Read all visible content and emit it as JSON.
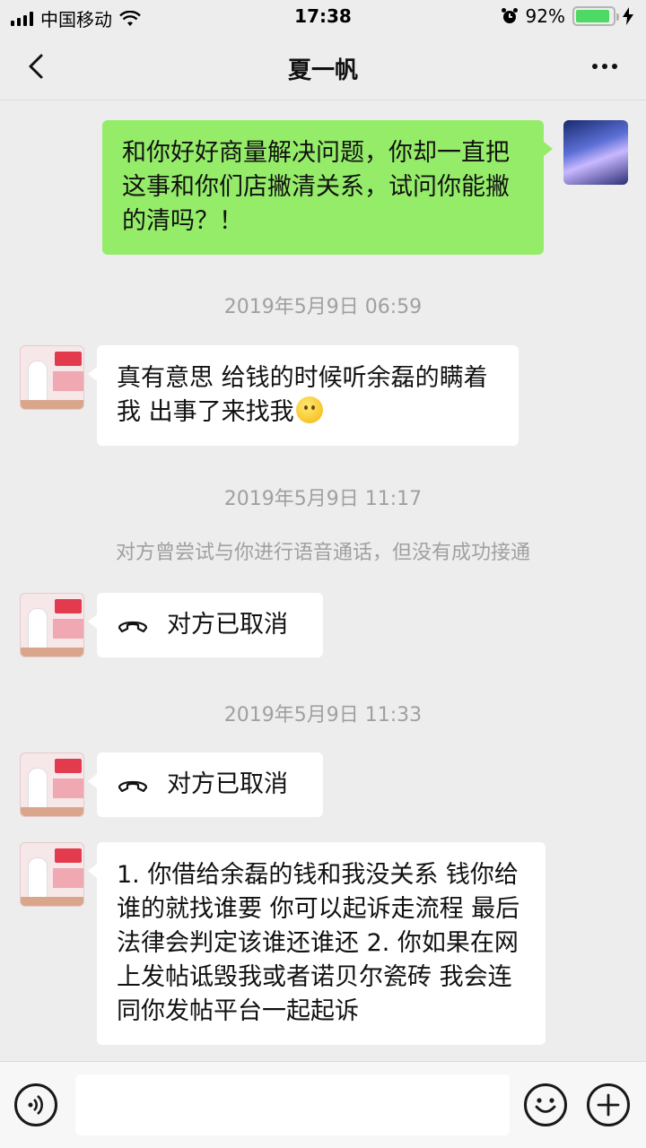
{
  "status_bar": {
    "carrier": "中国移动",
    "time": "17:38",
    "battery_percent": "92%",
    "battery_level": 0.92,
    "icons": [
      "signal-icon",
      "wifi-icon",
      "alarm-icon",
      "battery-icon",
      "charging-icon"
    ]
  },
  "nav": {
    "title": "夏一帆",
    "back_icon": "chevron-left-icon",
    "more_icon": "more-icon"
  },
  "messages": [
    {
      "type": "text",
      "side": "out",
      "text": "和你好好商量解决问题，你却一直把这事和你们店撇清关系，试问你能撇的清吗？！"
    },
    {
      "type": "timestamp",
      "text": "2019年5月9日 06:59"
    },
    {
      "type": "text",
      "side": "in",
      "text": "真有意思 给钱的时候听余磊的瞒着我 出事了来找我",
      "emoji": "smile-emoji"
    },
    {
      "type": "timestamp",
      "text": "2019年5月9日 11:17"
    },
    {
      "type": "system",
      "text": "对方曾尝试与你进行语音通话，但没有成功接通"
    },
    {
      "type": "call",
      "side": "in",
      "text": "对方已取消"
    },
    {
      "type": "timestamp",
      "text": "2019年5月9日 11:33"
    },
    {
      "type": "call",
      "side": "in",
      "text": "对方已取消"
    },
    {
      "type": "text",
      "side": "in",
      "text": "1. 你借给余磊的钱和我没关系 钱你给谁的就找谁要 你可以起诉走流程 最后法律会判定该谁还谁还 2. 你如果在网上发帖诋毁我或者诺贝尔瓷砖 我会连同你发帖平台一起起诉"
    }
  ],
  "input_bar": {
    "placeholder": "",
    "icons": [
      "voice-icon",
      "emoji-icon",
      "plus-icon"
    ]
  },
  "colors": {
    "background": "#ededed",
    "outgoing_bubble": "#95ec69",
    "incoming_bubble": "#ffffff",
    "timestamp_text": "#a0a0a0",
    "battery_green": "#4cd964"
  }
}
